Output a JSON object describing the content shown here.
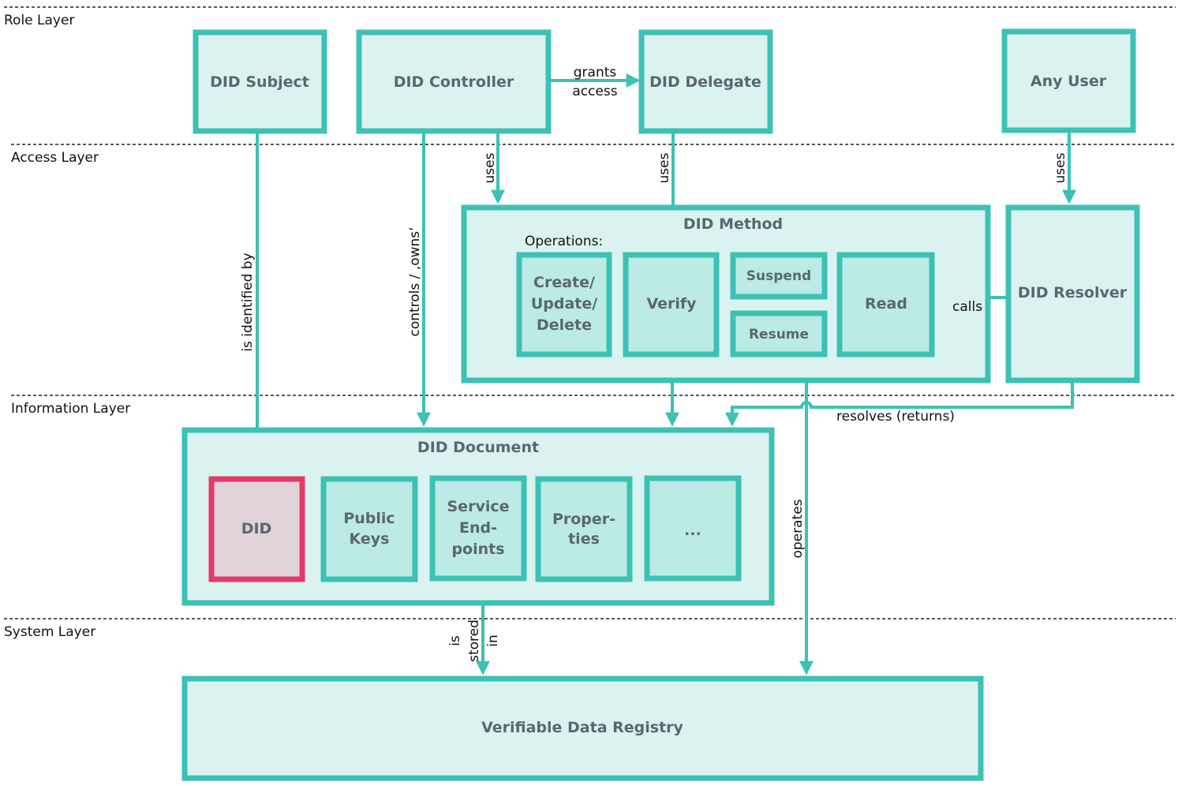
{
  "layers": {
    "role": "Role Layer",
    "access": "Access Layer",
    "information": "Information Layer",
    "system": "System Layer"
  },
  "roles": {
    "subject": "DID Subject",
    "controller": "DID Controller",
    "delegate": "DID Delegate",
    "any_user": "Any User"
  },
  "method": {
    "title": "DID Method",
    "operations_label": "Operations:",
    "ops": {
      "cud": [
        "Create/",
        "Update/",
        "Delete"
      ],
      "verify": "Verify",
      "suspend": "Suspend",
      "resume": "Resume",
      "read": "Read"
    }
  },
  "resolver": "DID Resolver",
  "document": {
    "title": "DID Document",
    "did": "DID",
    "public_keys": [
      "Public",
      "Keys"
    ],
    "service_endpoints": [
      "Service",
      "End-",
      "points"
    ],
    "properties": [
      "Proper-",
      "ties"
    ],
    "more": "..."
  },
  "registry": "Verifiable Data Registry",
  "edges": {
    "grants_access": [
      "grants",
      "access"
    ],
    "uses": "uses",
    "is_identified_by": "is identified by",
    "controls_owns": "controls / ‚owns‘",
    "calls": "calls",
    "resolves": "resolves (returns)",
    "operates": "operates",
    "is_stored_in": [
      "is",
      "stored",
      "in"
    ]
  },
  "colors": {
    "accent": "#3cc1b5",
    "box_fill": "#dbf3f0",
    "inner_fill": "#bceae4",
    "did_border": "#e43a68",
    "did_fill": "#dfd2d9",
    "label_text": "#5a6770"
  }
}
